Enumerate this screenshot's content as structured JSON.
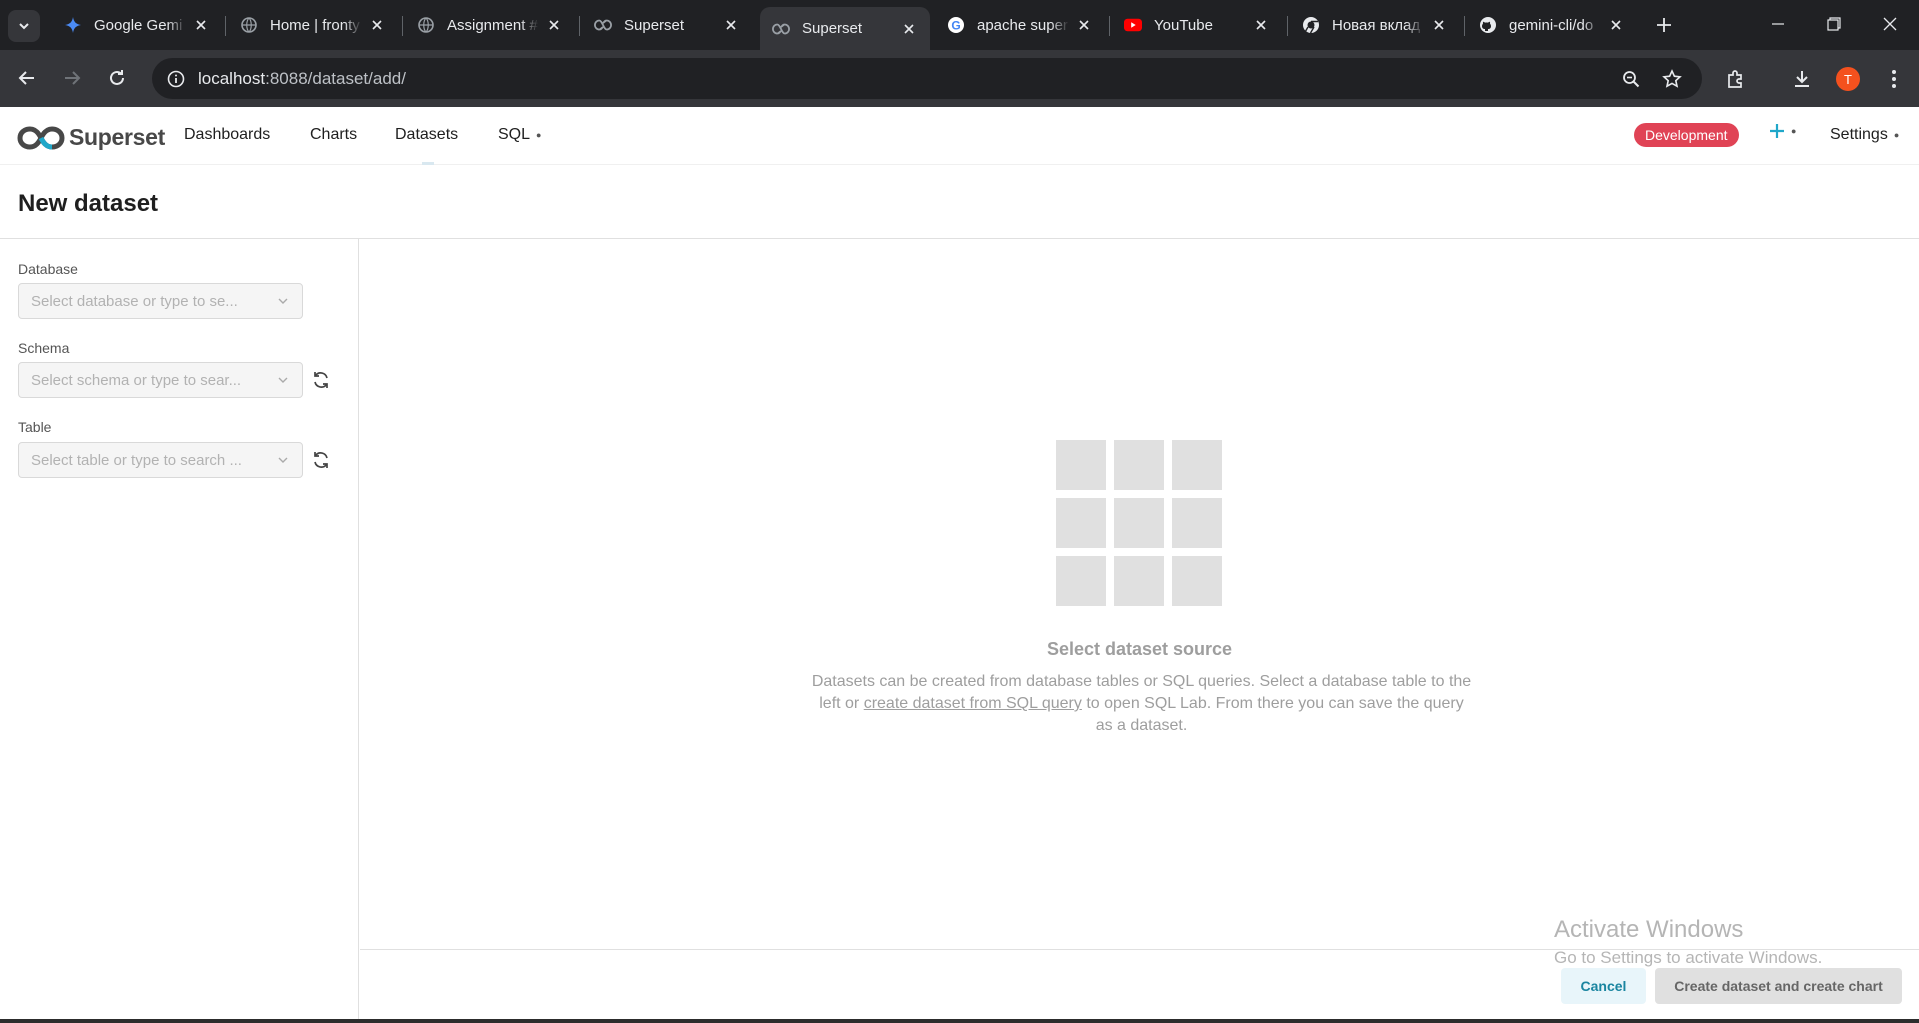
{
  "browser": {
    "tabs": [
      {
        "title": "Google Gemi",
        "icon": "gemini-icon"
      },
      {
        "title": "Home | fronty",
        "icon": "globe-icon"
      },
      {
        "title": "Assignment #",
        "icon": "globe-icon"
      },
      {
        "title": "Superset",
        "icon": "superset-icon"
      },
      {
        "title": "Superset",
        "icon": "superset-icon",
        "active": true
      },
      {
        "title": "apache super",
        "icon": "google-icon"
      },
      {
        "title": "YouTube",
        "icon": "youtube-icon"
      },
      {
        "title": "Новая вклад",
        "icon": "chrome-icon"
      },
      {
        "title": "gemini-cli/do",
        "icon": "github-icon"
      }
    ],
    "url_host": "localhost",
    "url_path": ":8088/dataset/add/",
    "profile_initial": "T"
  },
  "nav": {
    "brand": "Superset",
    "items": [
      "Dashboards",
      "Charts",
      "Datasets",
      "SQL"
    ],
    "environment": "Development",
    "settings": "Settings"
  },
  "page": {
    "title": "New dataset"
  },
  "form": {
    "database_label": "Database",
    "database_placeholder": "Select database or type to se...",
    "schema_label": "Schema",
    "schema_placeholder": "Select schema or type to sear...",
    "table_label": "Table",
    "table_placeholder": "Select table or type to search ..."
  },
  "empty_state": {
    "title": "Select dataset source",
    "desc_before": "Datasets can be created from database tables or SQL queries. Select a database table to the left or ",
    "link_text": "create dataset from SQL query",
    "desc_after": " to open SQL Lab. From there you can save the query as a dataset."
  },
  "footer": {
    "cancel": "Cancel",
    "create": "Create dataset and create chart"
  },
  "watermark": {
    "line1": "Activate Windows",
    "line2": "Go to Settings to activate Windows."
  },
  "colors": {
    "environment_badge": "#e04355",
    "accent": "#20a7c9"
  }
}
